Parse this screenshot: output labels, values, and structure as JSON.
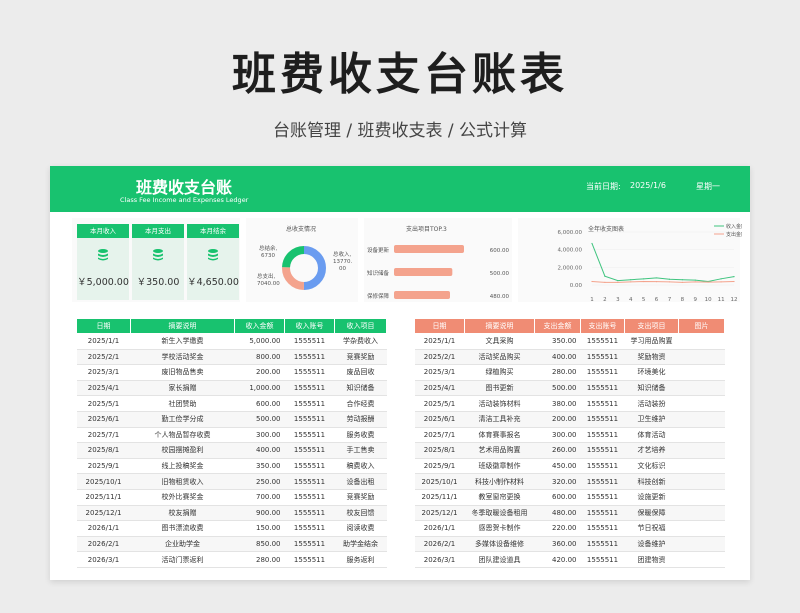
{
  "hero": {
    "title": "班费收支台账表",
    "subtitle": "台账管理 /  班费收支表  / 公式计算"
  },
  "header": {
    "title": "班费收支台账",
    "subtitle_en": "Class Fee Income and Expenses Ledger",
    "date_label": "当前日期:",
    "date": "2025/1/6",
    "weekday": "星期一"
  },
  "stats": [
    {
      "label": "本月收入",
      "value": "￥5,000.00"
    },
    {
      "label": "本月支出",
      "value": "￥350.00"
    },
    {
      "label": "本月结余",
      "value": "￥4,650.00"
    }
  ],
  "donut": {
    "title": "总收支情况",
    "label_balance": "总结余,",
    "value_balance": "6730",
    "label_expense": "总支出,",
    "value_expense": "7040.00",
    "label_income": "总收入,",
    "value_income": "13770.",
    "value_income_cont": "00",
    "colors": {
      "income": "#6a9cf0",
      "expense": "#f4a38d",
      "balance": "#18c26f"
    }
  },
  "top3": {
    "title": "支出项目TOP.3",
    "items": [
      {
        "label": "设备更新",
        "value": 600,
        "display": "600.00"
      },
      {
        "label": "知识储备",
        "value": 500,
        "display": "500.00"
      },
      {
        "label": "保修保障",
        "value": 480,
        "display": "480.00"
      }
    ],
    "color": "#f4a38d"
  },
  "chart_data": {
    "type": "line",
    "title": "全年收支图表",
    "x": [
      1,
      2,
      3,
      4,
      5,
      6,
      7,
      8,
      9,
      10,
      11,
      12
    ],
    "yticks": [
      "6,000.00",
      "4,000.00",
      "2,000.00",
      "0.00"
    ],
    "ylim": [
      0,
      6000
    ],
    "series": [
      {
        "name": "收入金额",
        "color": "#3fc47f",
        "values": [
          4700,
          1000,
          500,
          600,
          700,
          800,
          650,
          600,
          550,
          400,
          700,
          950
        ]
      },
      {
        "name": "支出金额",
        "color": "#f4a38d",
        "values": [
          400,
          300,
          300,
          350,
          400,
          380,
          350,
          300,
          350,
          330,
          350,
          400
        ]
      }
    ],
    "legend": "top-right"
  },
  "income_table": {
    "headers": [
      "日期",
      "摘要说明",
      "收入金额",
      "收入账号",
      "收入项目"
    ],
    "rows": [
      [
        "2025/1/1",
        "新生入学缴费",
        "5,000.00",
        "1555511",
        "学杂费收入"
      ],
      [
        "2025/2/1",
        "学校活动奖金",
        "800.00",
        "1555511",
        "竞赛奖励"
      ],
      [
        "2025/3/1",
        "废旧物品售卖",
        "200.00",
        "1555511",
        "废品回收"
      ],
      [
        "2025/4/1",
        "家长捐赠",
        "1,000.00",
        "1555511",
        "知识储备"
      ],
      [
        "2025/5/1",
        "社团赞助",
        "600.00",
        "1555511",
        "合作经费"
      ],
      [
        "2025/6/1",
        "勤工俭学分成",
        "500.00",
        "1555511",
        "劳动报酬"
      ],
      [
        "2025/7/1",
        "个人物品暂存收费",
        "300.00",
        "1555511",
        "服务收费"
      ],
      [
        "2025/8/1",
        "校园摆摊盈利",
        "400.00",
        "1555511",
        "手工售卖"
      ],
      [
        "2025/9/1",
        "线上投稿奖金",
        "350.00",
        "1555511",
        "稿费收入"
      ],
      [
        "2025/10/1",
        "旧物租赁收入",
        "250.00",
        "1555511",
        "设备出租"
      ],
      [
        "2025/11/1",
        "校外比赛奖金",
        "700.00",
        "1555511",
        "竞赛奖励"
      ],
      [
        "2025/12/1",
        "校友捐赠",
        "900.00",
        "1555511",
        "校友回馈"
      ],
      [
        "2026/1/1",
        "图书漂流收费",
        "150.00",
        "1555511",
        "阅读收费"
      ],
      [
        "2026/2/1",
        "企业助学金",
        "850.00",
        "1555511",
        "助学金结余"
      ],
      [
        "2026/3/1",
        "活动门票返利",
        "280.00",
        "1555511",
        "服务返利"
      ]
    ]
  },
  "expense_table": {
    "headers": [
      "日期",
      "摘要说明",
      "支出金额",
      "支出账号",
      "支出项目",
      "图片"
    ],
    "rows": [
      [
        "2025/1/1",
        "文具采购",
        "350.00",
        "1555511",
        "学习用品购置",
        ""
      ],
      [
        "2025/2/1",
        "活动奖品购买",
        "400.00",
        "1555511",
        "奖励物资",
        ""
      ],
      [
        "2025/3/1",
        "绿植购买",
        "280.00",
        "1555511",
        "环境美化",
        ""
      ],
      [
        "2025/4/1",
        "图书更新",
        "500.00",
        "1555511",
        "知识储备",
        ""
      ],
      [
        "2025/5/1",
        "活动装饰材料",
        "380.00",
        "1555511",
        "活动装扮",
        ""
      ],
      [
        "2025/6/1",
        "清洁工具补充",
        "200.00",
        "1555511",
        "卫生维护",
        ""
      ],
      [
        "2025/7/1",
        "体育赛事报名",
        "300.00",
        "1555511",
        "体育活动",
        ""
      ],
      [
        "2025/8/1",
        "艺术用品购置",
        "260.00",
        "1555511",
        "才艺培养",
        ""
      ],
      [
        "2025/9/1",
        "班级徽章制作",
        "450.00",
        "1555511",
        "文化标识",
        ""
      ],
      [
        "2025/10/1",
        "科技小制作材料",
        "320.00",
        "1555511",
        "科技创新",
        ""
      ],
      [
        "2025/11/1",
        "教室窗帘更换",
        "600.00",
        "1555511",
        "设施更新",
        ""
      ],
      [
        "2025/12/1",
        "冬季取暖设备租用",
        "480.00",
        "1555511",
        "保暖保障",
        ""
      ],
      [
        "2026/1/1",
        "感恩贺卡制作",
        "220.00",
        "1555511",
        "节日祝福",
        ""
      ],
      [
        "2026/2/1",
        "多媒体设备维修",
        "360.00",
        "1555511",
        "设备维护",
        ""
      ],
      [
        "2026/3/1",
        "团队建设道具",
        "420.00",
        "1555511",
        "团建物资",
        ""
      ]
    ]
  }
}
